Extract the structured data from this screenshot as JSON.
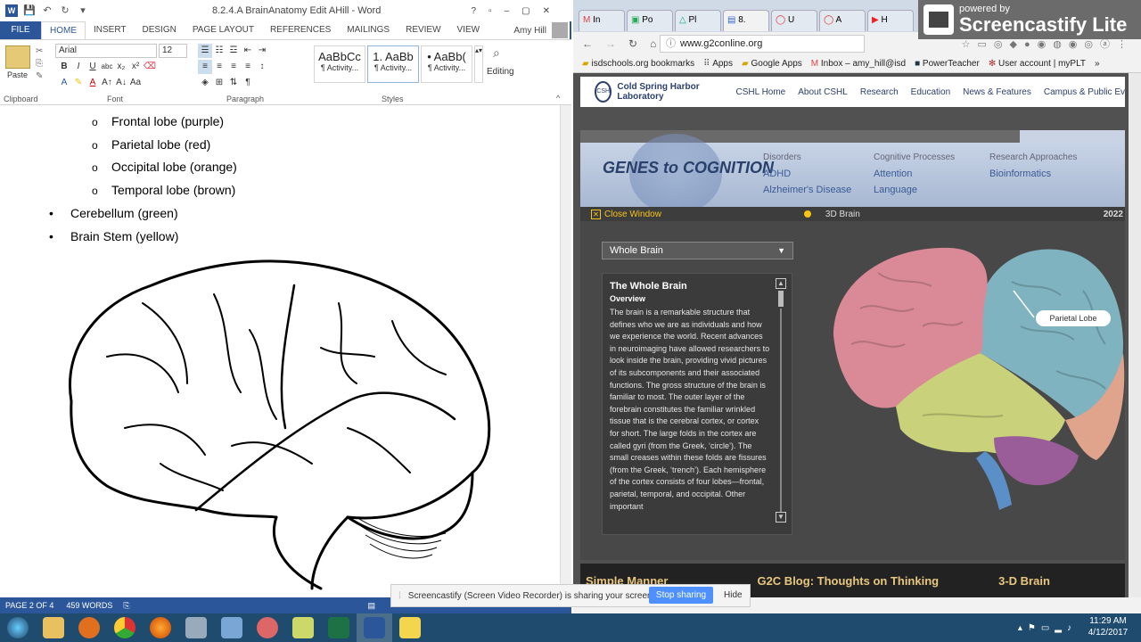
{
  "word": {
    "title": "8.2.4.A BrainAnatomy Edit AHill - Word",
    "tabs": [
      "FILE",
      "HOME",
      "INSERT",
      "DESIGN",
      "PAGE LAYOUT",
      "REFERENCES",
      "MAILINGS",
      "REVIEW",
      "VIEW"
    ],
    "user": "Amy Hill",
    "ribbon": {
      "font_name": "Arial",
      "font_size": "12",
      "paste": "Paste",
      "clipboard": "Clipboard",
      "font": "Font",
      "paragraph": "Paragraph",
      "styles": "Styles",
      "editing": "Editing",
      "style_tiles": [
        {
          "preview": "AaBbCc",
          "name": "¶ Activity..."
        },
        {
          "preview": "1. AaBb",
          "name": "¶ Activity..."
        },
        {
          "preview": "• AaBb(",
          "name": "¶ Activity..."
        }
      ]
    },
    "document": {
      "sub_items": [
        "Frontal lobe (purple)",
        "Parietal lobe (red)",
        "Occipital lobe (orange)",
        "Temporal lobe (brown)"
      ],
      "items": [
        "Cerebellum (green)",
        "Brain Stem (yellow)"
      ]
    },
    "status": {
      "page": "PAGE 2 OF 4",
      "words": "459 WORDS"
    }
  },
  "chrome": {
    "tabs": [
      "In",
      "Po",
      "Pl",
      "8.",
      "U",
      "A",
      "H"
    ],
    "url": "www.g2conline.org",
    "bookmarks": [
      "isdschools.org bookmarks",
      "Apps",
      "Google Apps",
      "Inbox – amy_hill@isd",
      "PowerTeacher",
      "User account | myPLT"
    ],
    "site": {
      "org": "Cold Spring Harbor Laboratory",
      "nav": [
        "CSHL Home",
        "About CSHL",
        "Research",
        "Education",
        "News & Features",
        "Campus & Public Ev"
      ],
      "g2c_logo": "GENES to COGNITION",
      "categories": [
        {
          "head": "Disorders",
          "links": [
            "ADHD",
            "Alzheimer's Disease"
          ]
        },
        {
          "head": "Cognitive Processes",
          "links": [
            "Attention",
            "Language"
          ]
        },
        {
          "head": "Research Approaches",
          "links": [
            "Bioinformatics"
          ]
        }
      ],
      "close_window": "Close Window",
      "viewer_title": "3D Brain",
      "viewer_year": "2022",
      "region": "Whole Brain",
      "info_title": "The Whole Brain",
      "info_sub": "Overview",
      "info_text": "The brain is a remarkable structure that defines who we are as individuals and how we experience the world.  Recent advances in neuroimaging have allowed researchers to look inside the brain, providing vivid pictures of its subcomponents and their associated functions.  The gross structure of the brain is familiar to most.  The outer layer of the forebrain constitutes the familiar wrinkled tissue that is the cerebral cortex, or cortex for short.  The large folds in the cortex are called gyri (from the Greek, ‘circle’).  The small creases within these folds are fissures (from the Greek, ‘trench’).  Each hemisphere of the cortex consists of four lobes—frontal, parietal, temporal, and occipital.  Other important",
      "hover_label": "Parietal Lobe",
      "bottom": [
        "Simple Manner",
        "G2C Blog: Thoughts on Thinking",
        "3-D Brain"
      ]
    }
  },
  "screencastify": {
    "powered": "powered by",
    "name": "Screencastify Lite",
    "share_msg": "Screencastify (Screen Video Recorder) is sharing your screen.",
    "stop": "Stop sharing",
    "hide": "Hide"
  },
  "taskbar": {
    "time": "11:29 AM",
    "date": "4/12/2017"
  },
  "colors": {
    "word_blue": "#2b579a",
    "frontal": "#d98a96",
    "parietal": "#7fb3c0",
    "temporal": "#c9d17a",
    "occipital": "#e0a38c",
    "cerebellum": "#9b5c9a",
    "stem": "#5a8fc7"
  }
}
